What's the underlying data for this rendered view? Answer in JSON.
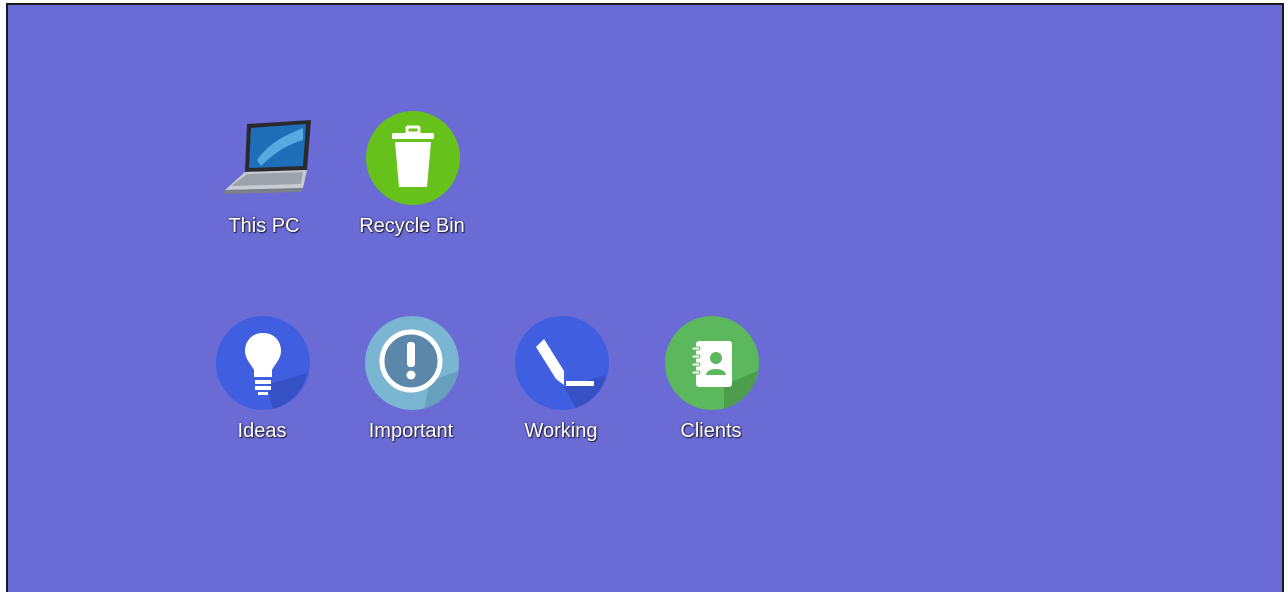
{
  "desktop": {
    "background_color": "#6b6bd6",
    "icons": [
      {
        "label": "This PC",
        "icon": "laptop-icon"
      },
      {
        "label": "Recycle Bin",
        "icon": "trash-can-icon",
        "color": "#66c21a"
      },
      {
        "label": "Ideas",
        "icon": "light-bulb-icon",
        "color": "#3f5fe0"
      },
      {
        "label": "Important",
        "icon": "exclamation-icon",
        "color": "#7ab6d2"
      },
      {
        "label": "Working",
        "icon": "pencil-icon",
        "color": "#3f5fe0"
      },
      {
        "label": "Clients",
        "icon": "address-book-icon",
        "color": "#5cb85c"
      }
    ]
  }
}
